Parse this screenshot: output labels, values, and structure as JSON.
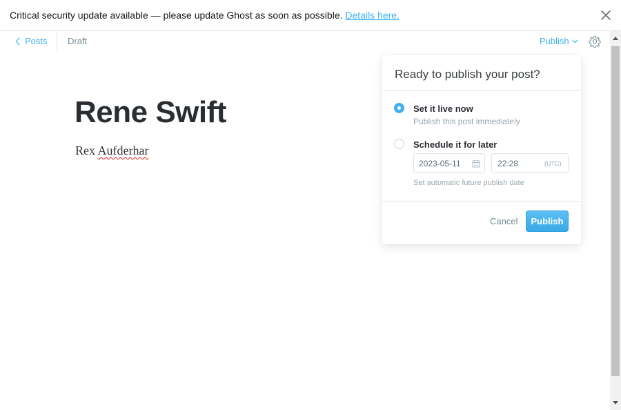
{
  "banner": {
    "message": "Critical security update available — please update Ghost as soon as possible.",
    "link_label": "Details here."
  },
  "header": {
    "back_label": "Posts",
    "status": "Draft",
    "publish_label": "Publish"
  },
  "post": {
    "title": "Rene Swift",
    "body_first": "Rex",
    "body_second": "Aufderhar"
  },
  "publish_menu": {
    "title": "Ready to publish your post?",
    "option_now_label": "Set it live now",
    "option_now_desc": "Publish this post immediately",
    "option_schedule_label": "Schedule it for later",
    "date_value": "2023-05-11",
    "time_value": "22:28",
    "timezone": "(UTC)",
    "schedule_hint": "Set automatic future publish date",
    "cancel_label": "Cancel",
    "publish_label": "Publish",
    "selected_option": "now"
  },
  "icons": {
    "close": "close-icon",
    "back": "chevron-left-icon",
    "caret": "chevron-down-icon",
    "settings": "gear-icon",
    "calendar": "calendar-icon"
  },
  "colors": {
    "accent": "#3eb0ef",
    "text": "#15171a",
    "muted": "#9aa7ae"
  }
}
